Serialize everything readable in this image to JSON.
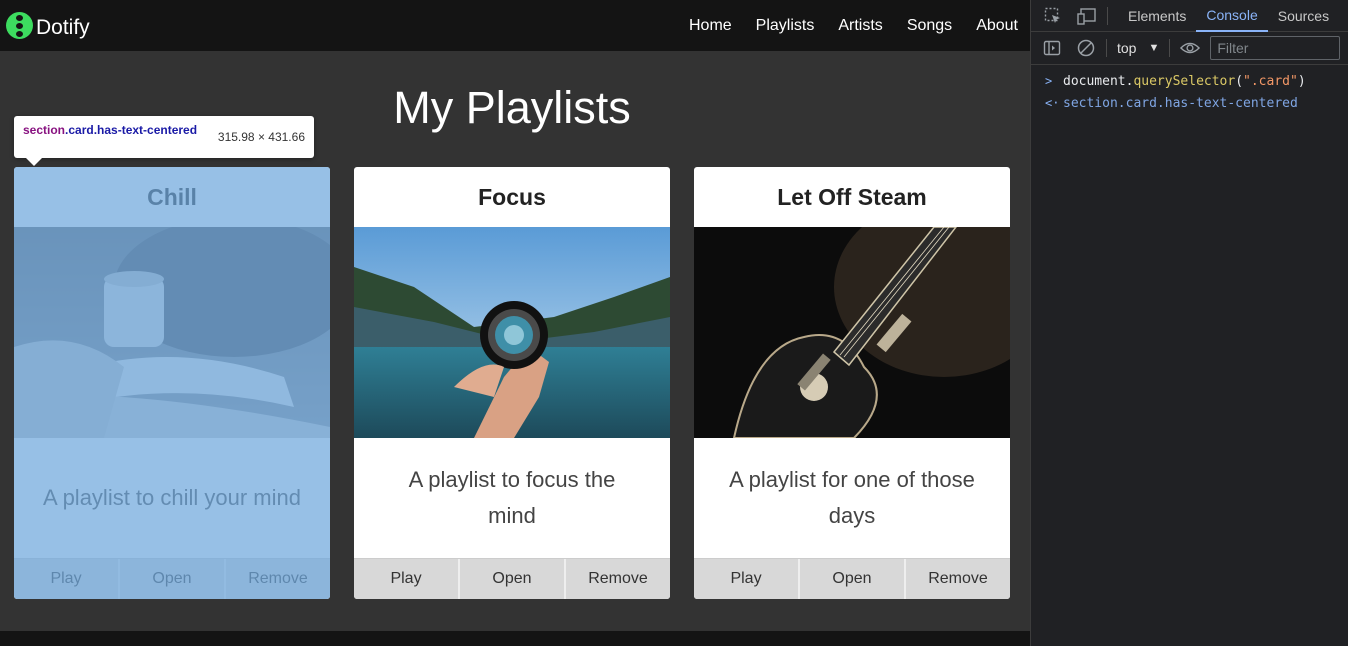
{
  "site": {
    "brand": "Dotify",
    "nav": [
      "Home",
      "Playlists",
      "Artists",
      "Songs",
      "About"
    ],
    "page_title": "My Playlists",
    "cards": [
      {
        "title": "Chill",
        "description": "A playlist to chill your mind",
        "image": "book-and-mug-photo",
        "buttons": [
          "Play",
          "Open",
          "Remove"
        ]
      },
      {
        "title": "Focus",
        "description": "A playlist to focus the mind",
        "image": "lens-over-lake-photo",
        "buttons": [
          "Play",
          "Open",
          "Remove"
        ]
      },
      {
        "title": "Let Off Steam",
        "description": "A playlist for one of those days",
        "image": "electric-guitar-photo",
        "buttons": [
          "Play",
          "Open",
          "Remove"
        ]
      }
    ],
    "colors": {
      "navbar": "#141414",
      "background": "#333333",
      "logo": "#3ddc5f",
      "highlight": "#6fa8dc"
    }
  },
  "inspector_tooltip": {
    "tag": "section",
    "classes": ".card.has-text-centered",
    "size": "315.98 × 431.66"
  },
  "devtools": {
    "tabs": [
      "Elements",
      "Console",
      "Sources"
    ],
    "active_tab": "Console",
    "context": "top",
    "filter_placeholder": "Filter",
    "console": {
      "input_object": "document.",
      "input_method": "querySelector",
      "input_open": "(",
      "input_arg": "\".card\"",
      "input_close": ")",
      "output": "section.card.has-text-centered"
    }
  }
}
